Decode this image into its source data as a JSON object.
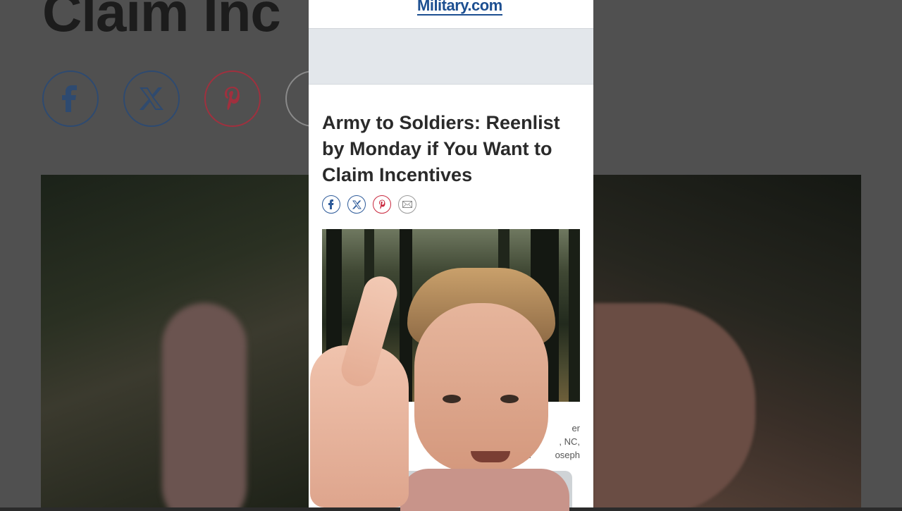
{
  "background": {
    "title_fragment": "Claim Inc",
    "social_icons": [
      "facebook-icon",
      "x-icon",
      "pinterest-icon",
      "email-icon"
    ]
  },
  "site": {
    "logo_text": "Military.com"
  },
  "article": {
    "headline": "Army to Soldiers: Reenlist by Monday if You Want to Claim Incentives",
    "share_icons": [
      "facebook-icon",
      "x-icon",
      "pinterest-icon",
      "email-icon"
    ],
    "caption_lines": [
      "er",
      "qua            , NC,",
      "(U.S. Ar         oseph"
    ]
  },
  "colors": {
    "brand": "#1d4f91",
    "pinterest": "#c9283e",
    "headline": "#2a2a2a",
    "ad_band": "#e3e7eb"
  }
}
